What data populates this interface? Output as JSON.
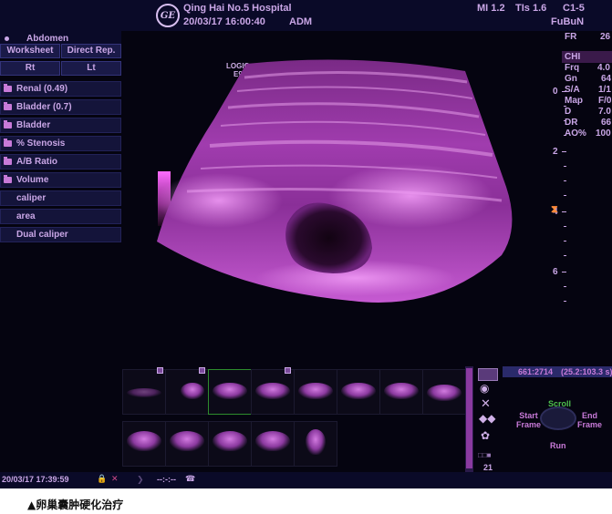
{
  "header": {
    "hospital": "Qing Hai No.5 Hospital",
    "datetime": "20/03/17 16:00:40",
    "operator": "ADM",
    "mi": "MI 1.2",
    "tis": "TIs 1.6",
    "probe": "C1-5",
    "preset": "FuBuN",
    "logo": "GE"
  },
  "left_panel": {
    "title": "Abdomen",
    "tabs": [
      "Worksheet",
      "Direct Rep."
    ],
    "sides": [
      "Rt",
      "Lt"
    ],
    "items": [
      {
        "label": "Renal (0.49)",
        "folder": true
      },
      {
        "label": "Bladder (0.7)",
        "folder": true
      },
      {
        "label": "Bladder",
        "folder": true
      },
      {
        "label": "% Stenosis",
        "folder": true
      },
      {
        "label": "A/B Ratio",
        "folder": true
      },
      {
        "label": "Volume",
        "folder": true
      },
      {
        "label": "caliper",
        "folder": false
      },
      {
        "label": "area",
        "folder": false
      },
      {
        "label": "Dual caliper",
        "folder": false
      }
    ]
  },
  "image": {
    "logiq_line1": "LOGIQ",
    "logiq_line2": "E9"
  },
  "params": {
    "fr_label": "FR",
    "fr_value": "26",
    "chi": "CHI",
    "rows": [
      {
        "label": "Frq",
        "value": "4.0"
      },
      {
        "label": "Gn",
        "value": "64"
      },
      {
        "label": "S/A",
        "value": "1/1"
      },
      {
        "label": "Map",
        "value": "F/0"
      },
      {
        "label": "D",
        "value": "7.0"
      },
      {
        "label": "DR",
        "value": "66"
      },
      {
        "label": "AO%",
        "value": "100"
      }
    ]
  },
  "depth_scale": [
    "0",
    "2",
    "4",
    "6"
  ],
  "cine": {
    "frames": "661:2714",
    "time": "(25.2:103.3 s)",
    "scroll": "Scroll",
    "start_frame": "Start\nFrame",
    "end_frame": "End\nFrame",
    "run": "Run",
    "count": "21"
  },
  "footer": {
    "datetime": "20/03/17 17:39:59"
  },
  "caption": "▲卵巢囊肿硬化治疗",
  "colors": {
    "background": "#050410",
    "panel": "#14143a",
    "text": "#c9a6e6",
    "image_tint": "#c85ad0",
    "cine_green": "#4ec04e"
  }
}
